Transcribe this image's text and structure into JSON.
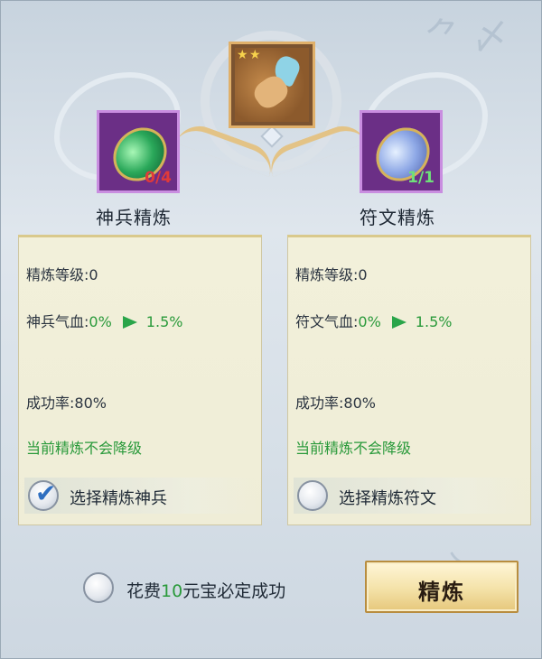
{
  "center_item": {
    "stars": 2,
    "icon": "feather-charm-icon"
  },
  "left": {
    "title": "神兵精炼",
    "count": "0/4",
    "count_color": "#e03a3a",
    "icon": "green-gem-icon",
    "refine_level": "精炼等级:0",
    "hp_label": "神兵气血:",
    "hp_from": "0%",
    "hp_to": "1.5%",
    "success_rate": "成功率:80%",
    "no_downgrade": "当前精炼不会降级",
    "select_label": "选择精炼神兵",
    "selected": true
  },
  "right": {
    "title": "符文精炼",
    "count": "1/1",
    "count_color": "#6ee07a",
    "icon": "blue-gem-icon",
    "refine_level": "精炼等级:0",
    "hp_label": "符文气血:",
    "hp_from": "0%",
    "hp_to": "1.5%",
    "success_rate": "成功率:80%",
    "no_downgrade": "当前精炼不会降级",
    "select_label": "选择精炼符文",
    "selected": false
  },
  "cost": {
    "prefix": "花费",
    "amount": "10",
    "suffix": "元宝必定成功",
    "selected": false
  },
  "refine_button": "精炼"
}
